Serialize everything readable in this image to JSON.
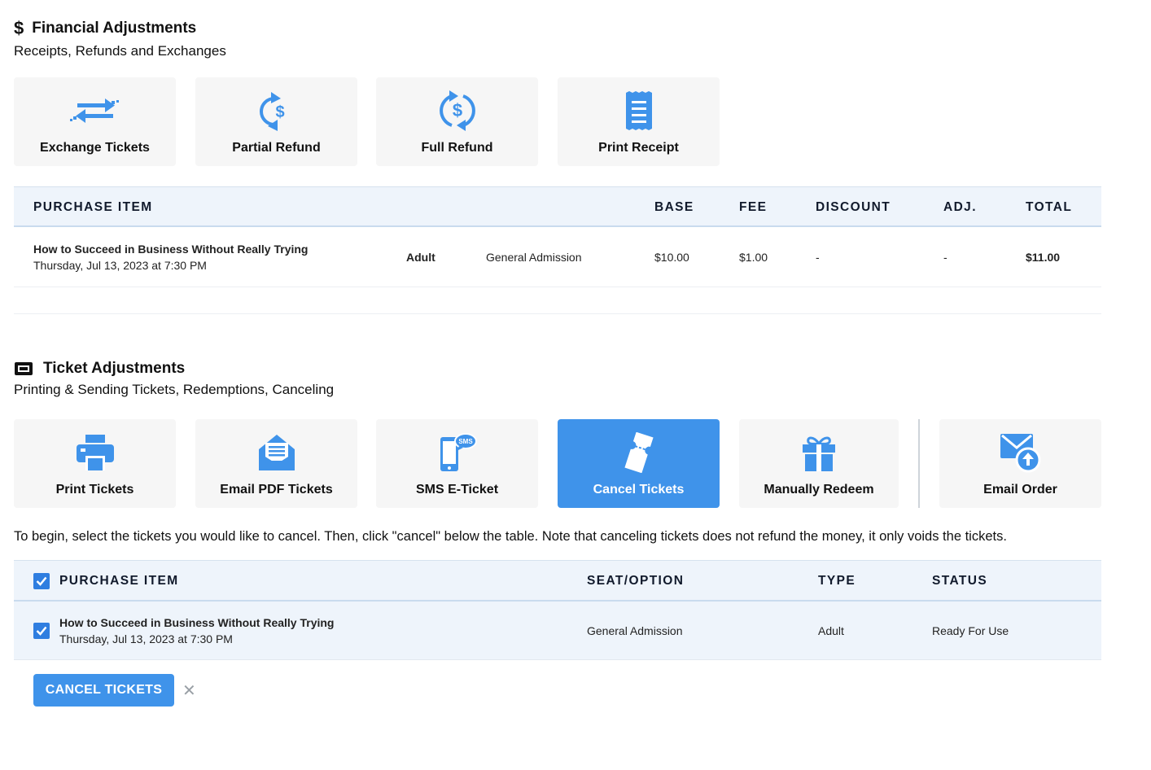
{
  "colors": {
    "accent": "#3f93ea",
    "tile_bg": "#f6f6f6",
    "header_bg": "#eef4fb"
  },
  "financial": {
    "title": "Financial Adjustments",
    "subtitle": "Receipts, Refunds and Exchanges",
    "icon": "dollar-icon",
    "tiles": [
      {
        "label": "Exchange Tickets",
        "icon": "exchange-arrows-icon"
      },
      {
        "label": "Partial Refund",
        "icon": "partial-refund-icon"
      },
      {
        "label": "Full Refund",
        "icon": "full-refund-icon"
      },
      {
        "label": "Print Receipt",
        "icon": "receipt-icon"
      }
    ],
    "table": {
      "headers": {
        "item": "PURCHASE ITEM",
        "base": "BASE",
        "fee": "FEE",
        "discount": "DISCOUNT",
        "adj": "ADJ.",
        "total": "TOTAL"
      },
      "rows": [
        {
          "name": "How to Succeed in Business Without Really Trying",
          "date": "Thursday, Jul 13, 2023 at 7:30 PM",
          "type": "Adult",
          "seat": "General Admission",
          "base": "$10.00",
          "fee": "$1.00",
          "discount": "-",
          "adj": "-",
          "total": "$11.00"
        }
      ]
    }
  },
  "tickets": {
    "title": "Ticket Adjustments",
    "subtitle": "Printing & Sending Tickets, Redemptions, Canceling",
    "icon": "ticket-icon",
    "tiles": [
      {
        "label": "Print Tickets",
        "icon": "printer-icon"
      },
      {
        "label": "Email PDF Tickets",
        "icon": "email-pdf-icon"
      },
      {
        "label": "SMS E-Ticket",
        "icon": "sms-phone-icon",
        "badge": "SMS"
      },
      {
        "label": "Cancel Tickets",
        "icon": "cancel-ticket-icon",
        "active": true
      },
      {
        "label": "Manually Redeem",
        "icon": "gift-icon"
      },
      {
        "label": "Email Order",
        "icon": "email-order-icon"
      }
    ],
    "instructions": "To begin, select the tickets you would like to cancel. Then, click \"cancel\" below the table. Note that canceling tickets does not refund the money, it only voids the tickets.",
    "table": {
      "headers": {
        "item": "PURCHASE ITEM",
        "seat": "SEAT/OPTION",
        "type": "TYPE",
        "status": "STATUS"
      },
      "rows": [
        {
          "name": "How to Succeed in Business Without Really Trying",
          "date": "Thursday, Jul 13, 2023 at 7:30 PM",
          "seat": "General Admission",
          "type": "Adult",
          "status": "Ready For Use",
          "checked": true
        }
      ]
    },
    "cancel_button": "CANCEL TICKETS",
    "close_symbol": "✕"
  }
}
